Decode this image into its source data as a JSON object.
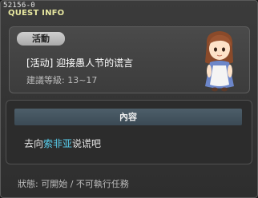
{
  "window": {
    "quest_id": "52156-0",
    "title": "QUEST INFO"
  },
  "quest": {
    "tag": "活動",
    "name": "[活动] 迎接愚人节的谎言",
    "level": "建議等級: 13~17",
    "npc_icon": "npc-girl-portrait"
  },
  "content": {
    "header": "內容",
    "desc_prefix": "去向",
    "desc_npc": "索非亚",
    "desc_suffix": "说谎吧"
  },
  "status": {
    "text": "狀態: 可開始 / 不可執行任務"
  },
  "colors": {
    "title": "#e7e7a0",
    "npc_link": "#59d0f0",
    "header_bg": "#44545f"
  }
}
